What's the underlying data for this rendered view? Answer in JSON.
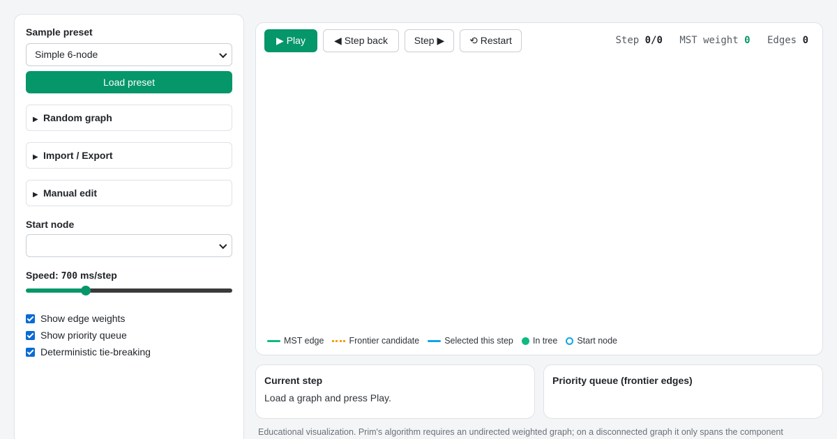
{
  "sidebar": {
    "preset_label": "Sample preset",
    "preset_value": "Simple 6-node",
    "load_button": "Load preset",
    "details": [
      "Random graph",
      "Import / Export",
      "Manual edit"
    ],
    "start_node_label": "Start node",
    "start_node_value": "",
    "speed_label": "Speed:",
    "speed_value": "700",
    "speed_unit": "ms/step",
    "speed_level_percent": 29,
    "checkboxes": [
      {
        "label": "Show edge weights",
        "checked": true
      },
      {
        "label": "Show priority queue",
        "checked": true
      },
      {
        "label": "Deterministic tie-breaking",
        "checked": true
      }
    ]
  },
  "toolbar": {
    "play": "▶ Play",
    "step_back": "◀ Step back",
    "step": "Step ▶",
    "restart": "⟲ Restart"
  },
  "stats": {
    "step_label": "Step",
    "step_value": "0/0",
    "mst_label": "MST weight",
    "mst_value": "0",
    "edges_label": "Edges",
    "edges_value": "0"
  },
  "legend": {
    "mst_edge": "MST edge",
    "frontier": "Frontier candidate",
    "selected": "Selected this step",
    "in_tree": "In tree",
    "start_node": "Start node"
  },
  "current_step": {
    "title": "Current step",
    "text": "Load a graph and press Play."
  },
  "priority_queue": {
    "title": "Priority queue (frontier edges)"
  },
  "footnote": "Educational visualization. Prim's algorithm requires an undirected weighted graph; on a disconnected graph it only spans the component",
  "colors": {
    "accent": "#059669",
    "frontier": "#f59e0b",
    "selected": "#0ea5e9",
    "in_tree": "#10b981"
  }
}
